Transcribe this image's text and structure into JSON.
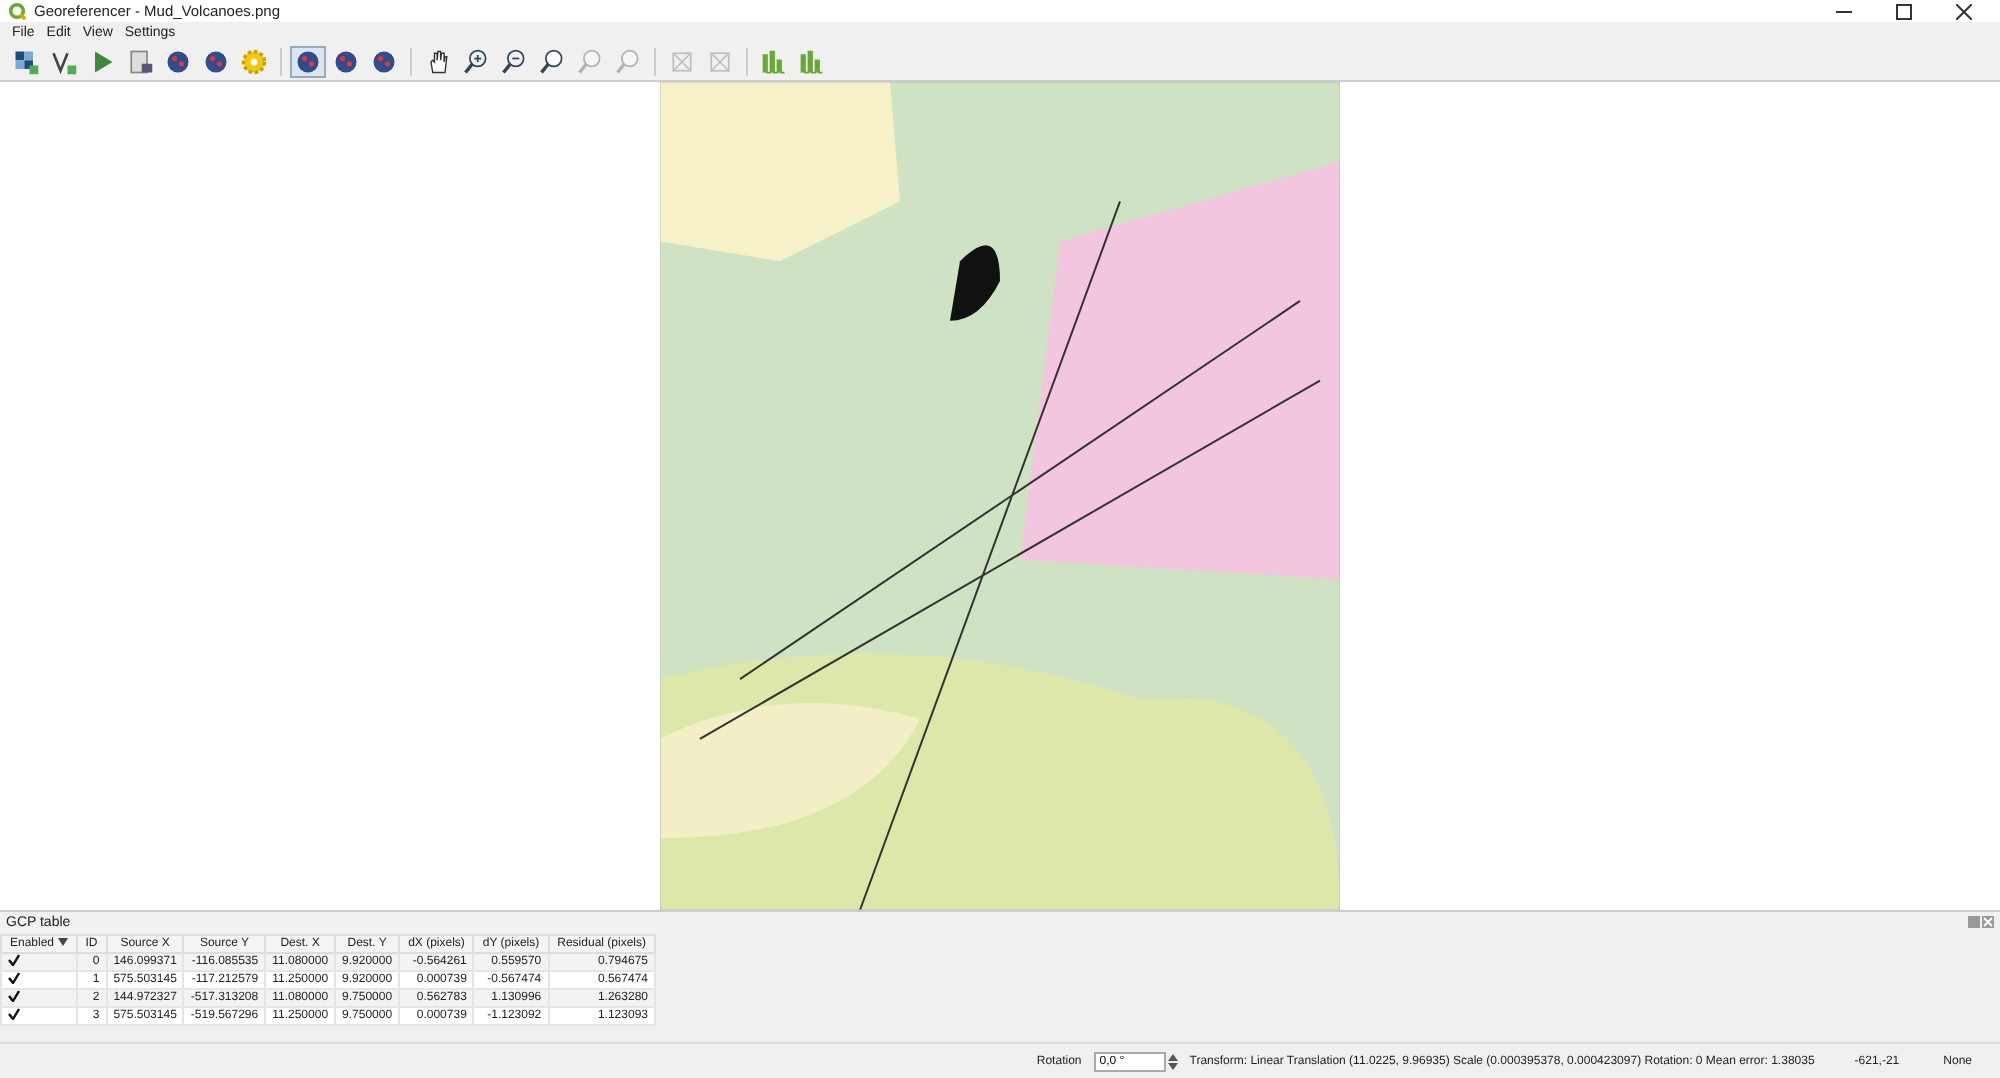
{
  "window": {
    "title": "Georeferencer - Mud_Volcanoes.png"
  },
  "menu": [
    "File",
    "Edit",
    "View",
    "Settings"
  ],
  "toolbar": [
    {
      "kind": "grid",
      "selected": false
    },
    {
      "kind": "vector",
      "selected": false
    },
    {
      "kind": "play",
      "selected": false
    },
    {
      "kind": "doc",
      "selected": false
    },
    {
      "kind": "globe",
      "selected": false
    },
    {
      "kind": "globe",
      "selected": false
    },
    {
      "kind": "gear",
      "selected": false
    },
    {
      "kind": "sep"
    },
    {
      "kind": "globe",
      "selected": true
    },
    {
      "kind": "globe",
      "selected": false
    },
    {
      "kind": "globe",
      "selected": false
    },
    {
      "kind": "sep"
    },
    {
      "kind": "hand",
      "selected": false
    },
    {
      "kind": "zoomin",
      "selected": false
    },
    {
      "kind": "zoomout",
      "selected": false
    },
    {
      "kind": "zoom",
      "selected": false
    },
    {
      "kind": "zoom",
      "disabled": true,
      "selected": false
    },
    {
      "kind": "zoom",
      "disabled": true,
      "selected": false
    },
    {
      "kind": "sep"
    },
    {
      "kind": "frame",
      "disabled": true,
      "selected": false
    },
    {
      "kind": "frame",
      "disabled": true,
      "selected": false
    },
    {
      "kind": "sep"
    },
    {
      "kind": "chart",
      "selected": false
    },
    {
      "kind": "chart",
      "selected": false
    }
  ],
  "gcp_table": {
    "title": "GCP table",
    "enabled_column": "Enabled",
    "columns": [
      "ID",
      "Source X",
      "Source Y",
      "Dest. X",
      "Dest. Y",
      "dX (pixels)",
      "dY (pixels)",
      "Residual (pixels)"
    ],
    "rows": [
      {
        "enabled": true,
        "cells": [
          "0",
          "146.099371",
          "-116.085535",
          "11.080000",
          "9.920000",
          "-0.564261",
          "0.559570",
          "0.794675"
        ]
      },
      {
        "enabled": true,
        "cells": [
          "1",
          "575.503145",
          "-117.212579",
          "11.250000",
          "9.920000",
          "0.000739",
          "-0.567474",
          "0.567474"
        ]
      },
      {
        "enabled": true,
        "cells": [
          "2",
          "144.972327",
          "-517.313208",
          "11.080000",
          "9.750000",
          "0.562783",
          "1.130996",
          "1.263280"
        ]
      },
      {
        "enabled": true,
        "cells": [
          "3",
          "575.503145",
          "-519.567296",
          "11.250000",
          "9.750000",
          "0.000739",
          "-1.123092",
          "1.123093"
        ]
      }
    ]
  },
  "status_bar": {
    "rotation_label": "Rotation",
    "rotation_value": "0,0 °",
    "transform": "Transform: Linear Translation (11.0225, 9.96935) Scale (0.000395378, 0.000423097) Rotation: 0 Mean error: 1.38035",
    "coordinates": "-621,-21",
    "crs": "None"
  }
}
